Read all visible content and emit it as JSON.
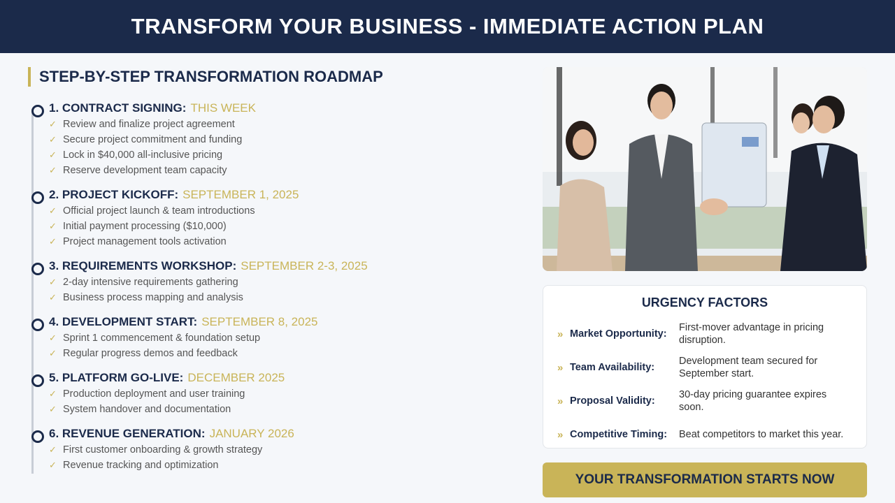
{
  "header": {
    "title": "TRANSFORM YOUR BUSINESS - IMMEDIATE ACTION PLAN"
  },
  "roadmap": {
    "title": "STEP-BY-STEP TRANSFORMATION ROADMAP",
    "steps": [
      {
        "title": "1. CONTRACT SIGNING:",
        "date": "THIS WEEK",
        "items": [
          "Review and finalize project agreement",
          "Secure project commitment and funding",
          "Lock in $40,000 all-inclusive pricing",
          "Reserve development team capacity"
        ]
      },
      {
        "title": "2. PROJECT KICKOFF:",
        "date": "SEPTEMBER 1, 2025",
        "items": [
          "Official project launch & team introductions",
          "Initial payment processing ($10,000)",
          "Project management tools activation"
        ]
      },
      {
        "title": "3. REQUIREMENTS WORKSHOP:",
        "date": "SEPTEMBER 2-3, 2025",
        "items": [
          "2-day intensive requirements gathering",
          "Business process mapping and analysis"
        ]
      },
      {
        "title": "4. DEVELOPMENT START:",
        "date": "SEPTEMBER 8, 2025",
        "items": [
          "Sprint 1 commencement & foundation setup",
          "Regular progress demos and feedback"
        ]
      },
      {
        "title": "5. PLATFORM GO-LIVE:",
        "date": "DECEMBER 2025",
        "items": [
          "Production deployment and user training",
          "System handover and documentation"
        ]
      },
      {
        "title": "6. REVENUE GENERATION:",
        "date": "JANUARY 2026",
        "items": [
          "First customer onboarding & growth strategy",
          "Revenue tracking and optimization"
        ]
      }
    ]
  },
  "urgency": {
    "title": "URGENCY FACTORS",
    "factors": [
      {
        "label": "Market Opportunity:",
        "text": "First-mover advantage in pricing disruption."
      },
      {
        "label": "Team Availability:",
        "text": "Development team secured for September start."
      },
      {
        "label": "Proposal Validity:",
        "text": "30-day pricing guarantee expires soon."
      },
      {
        "label": "Competitive Timing:",
        "text": "Beat competitors to market this year."
      }
    ]
  },
  "cta": {
    "label": "YOUR TRANSFORMATION STARTS NOW"
  },
  "icons": {
    "check": "check-icon",
    "arrow": "double-chevron-right-icon"
  },
  "colors": {
    "navy": "#1b2a4a",
    "gold": "#c9b458",
    "background": "#f5f7fa"
  }
}
